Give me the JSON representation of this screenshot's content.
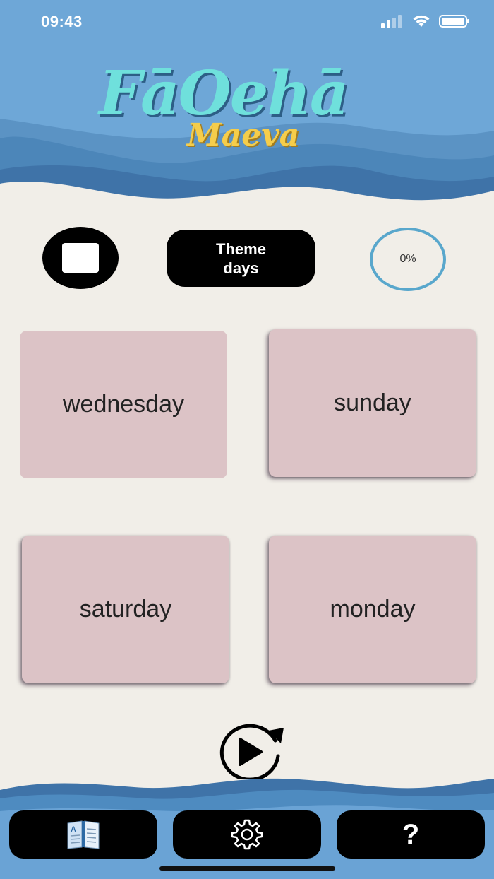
{
  "status_bar": {
    "time": "09:43"
  },
  "logo": {
    "title": "FāOehā",
    "subtitle": "Maeva"
  },
  "controls": {
    "stop_icon": "stop-square-icon",
    "theme_button_label": "Theme days",
    "progress_value": 0,
    "progress_label": "0%"
  },
  "cards": [
    {
      "label": "wednesday"
    },
    {
      "label": "sunday"
    },
    {
      "label": "saturday"
    },
    {
      "label": "monday"
    }
  ],
  "replay": {
    "icon": "replay-play-icon"
  },
  "bottom_nav": {
    "items": [
      {
        "icon": "glossary-book-icon"
      },
      {
        "icon": "gear-icon"
      },
      {
        "icon": "help-icon",
        "label": "?"
      }
    ]
  },
  "colors": {
    "background": "#f1eee8",
    "card": "#dcc3c6",
    "sky": "#6fa8d7",
    "wave_dark": "#3d72a8",
    "progress_ring": "#59a7cc"
  }
}
